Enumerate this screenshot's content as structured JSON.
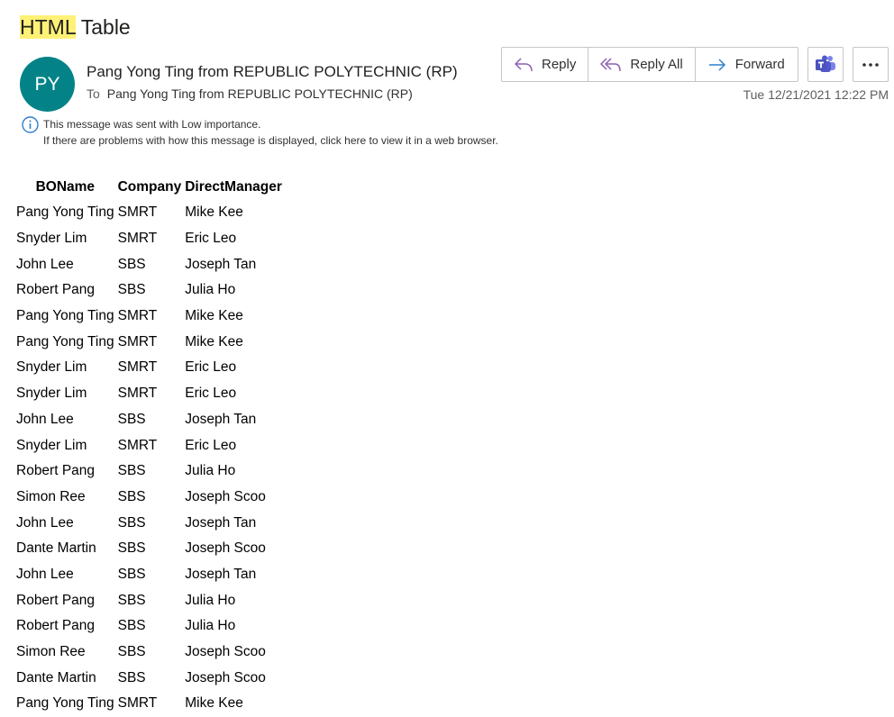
{
  "subject": {
    "highlight": "HTML",
    "rest": " Table"
  },
  "sender": {
    "initials": "PY",
    "avatar_color": "#038387",
    "name": "Pang Yong Ting from REPUBLIC POLYTECHNIC (RP)",
    "to_label": "To",
    "to_name": "Pang Yong Ting from REPUBLIC POLYTECHNIC (RP)"
  },
  "actions": {
    "reply": "Reply",
    "reply_all": "Reply All",
    "forward": "Forward",
    "teams_icon": "teams-icon",
    "more_icon": "more-icon"
  },
  "datetime": "Tue 12/21/2021 12:22 PM",
  "info": {
    "line1": "This message was sent with Low importance.",
    "line2": "If there are problems with how this message is displayed, click here to view it in a web browser."
  },
  "table": {
    "headers": [
      "BOName",
      "Company",
      "DirectManager"
    ],
    "rows": [
      [
        "Pang Yong Ting",
        "SMRT",
        "Mike Kee"
      ],
      [
        "Snyder Lim",
        "SMRT",
        "Eric Leo"
      ],
      [
        "John Lee",
        "SBS",
        "Joseph Tan"
      ],
      [
        "Robert Pang",
        "SBS",
        "Julia Ho"
      ],
      [
        "Pang Yong Ting",
        "SMRT",
        "Mike Kee"
      ],
      [
        "Pang Yong Ting",
        "SMRT",
        "Mike Kee"
      ],
      [
        "Snyder Lim",
        "SMRT",
        "Eric Leo"
      ],
      [
        "Snyder Lim",
        "SMRT",
        "Eric Leo"
      ],
      [
        "John Lee",
        "SBS",
        "Joseph Tan"
      ],
      [
        "Snyder Lim",
        "SMRT",
        "Eric Leo"
      ],
      [
        "Robert Pang",
        "SBS",
        "Julia Ho"
      ],
      [
        "Simon Ree",
        "SBS",
        "Joseph Scoo"
      ],
      [
        "John Lee",
        "SBS",
        "Joseph Tan"
      ],
      [
        "Dante Martin",
        "SBS",
        "Joseph Scoo"
      ],
      [
        "John Lee",
        "SBS",
        "Joseph Tan"
      ],
      [
        "Robert Pang",
        "SBS",
        "Julia Ho"
      ],
      [
        "Robert Pang",
        "SBS",
        "Julia Ho"
      ],
      [
        "Simon Ree",
        "SBS",
        "Joseph Scoo"
      ],
      [
        "Dante Martin",
        "SBS",
        "Joseph Scoo"
      ],
      [
        "Pang Yong Ting",
        "SMRT",
        "Mike Kee"
      ]
    ]
  }
}
